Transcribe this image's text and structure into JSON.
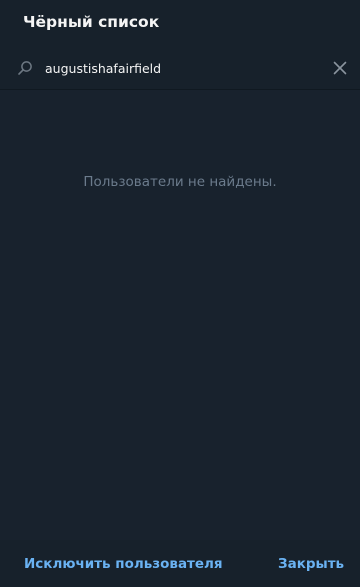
{
  "dialog": {
    "title": "Чёрный список"
  },
  "search": {
    "value": "augustishafairfield",
    "icon": "search-icon",
    "clear_icon": "close-icon"
  },
  "list": {
    "empty_message": "Пользователи не найдены."
  },
  "footer": {
    "exclude_label": "Исключить пользователя",
    "close_label": "Закрыть"
  },
  "colors": {
    "background": "#17212b",
    "text": "#f5f5f5",
    "muted": "#6b7b8c",
    "accent": "#6ab2f2"
  }
}
